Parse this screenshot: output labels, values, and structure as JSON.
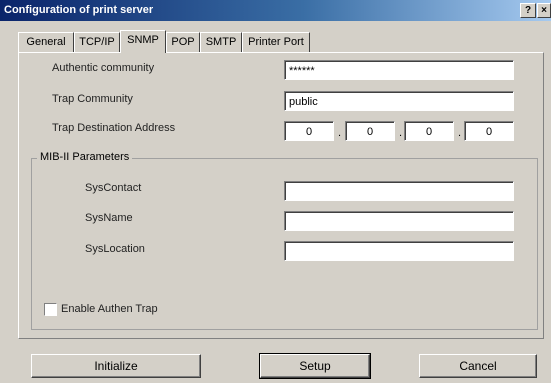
{
  "window": {
    "title": "Configuration of print server",
    "help_label": "?",
    "close_label": "×"
  },
  "tabs": [
    {
      "label": "General"
    },
    {
      "label": "TCP/IP"
    },
    {
      "label": "SNMP"
    },
    {
      "label": "POP"
    },
    {
      "label": "SMTP"
    },
    {
      "label": "Printer Port"
    }
  ],
  "active_tab": "SNMP",
  "snmp": {
    "authentic_community": {
      "label": "Authentic community",
      "value": "******"
    },
    "trap_community": {
      "label": "Trap Community",
      "value": "public"
    },
    "trap_destination": {
      "label": "Trap Destination Address",
      "octets": [
        "0",
        "0",
        "0",
        "0"
      ],
      "separator": "."
    }
  },
  "mib": {
    "group_title": "MIB-II Parameters",
    "sys_contact": {
      "label": "SysContact",
      "value": ""
    },
    "sys_name": {
      "label": "SysName",
      "value": ""
    },
    "sys_location": {
      "label": "SysLocation",
      "value": ""
    }
  },
  "enable_authen_trap": {
    "label": "Enable Authen Trap",
    "checked": false
  },
  "buttons": {
    "initialize": "Initialize",
    "setup": "Setup",
    "cancel": "Cancel"
  }
}
